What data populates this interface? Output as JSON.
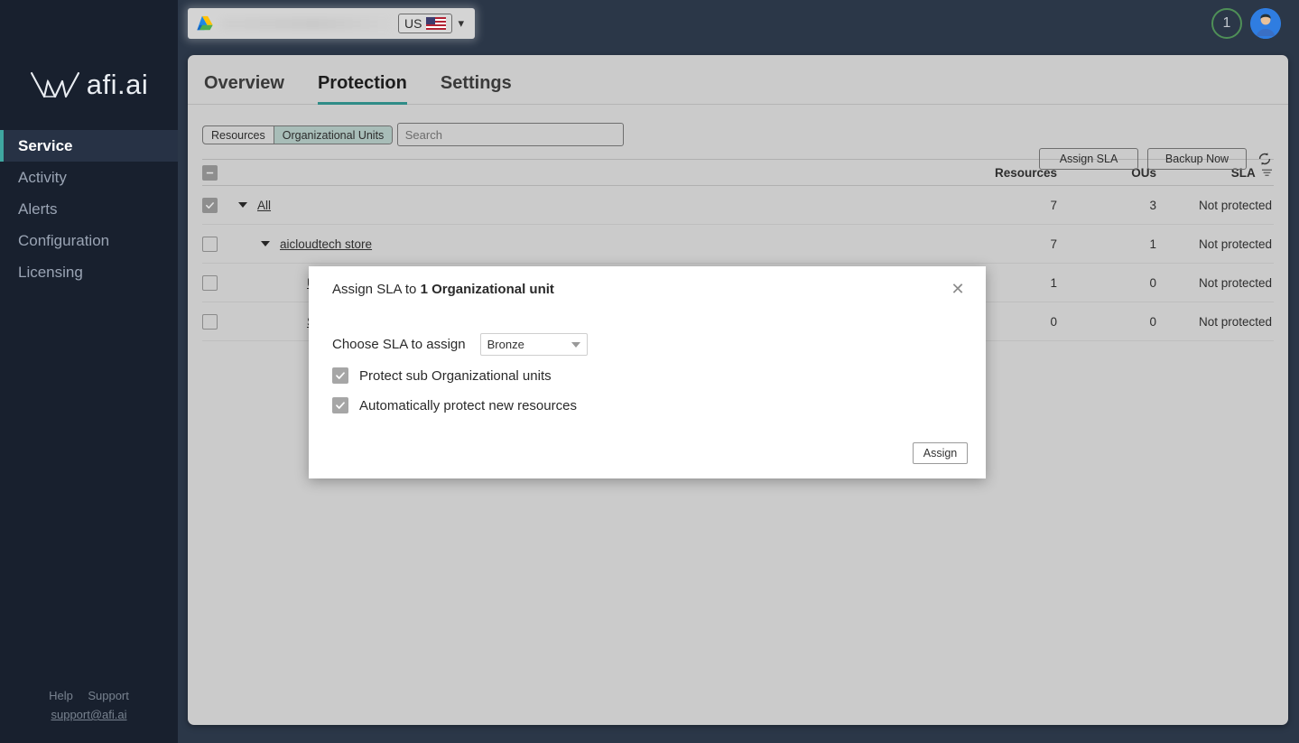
{
  "brand": {
    "name": "afi.ai",
    "accent": "#3fa6a0",
    "sidebar_bg": "#18202e"
  },
  "sidebar": {
    "items": [
      {
        "label": "Service",
        "active": true
      },
      {
        "label": "Activity",
        "active": false
      },
      {
        "label": "Alerts",
        "active": false
      },
      {
        "label": "Configuration",
        "active": false
      },
      {
        "label": "Licensing",
        "active": false
      }
    ],
    "footer": {
      "help": "Help",
      "support": "Support",
      "email": "support@afi.ai"
    }
  },
  "topbar": {
    "account_icon": "google-drive-icon",
    "account_name": "",
    "region": "US",
    "region_flag": "us-flag-icon",
    "notification_count": "1",
    "avatar": "user-avatar"
  },
  "tabs": [
    {
      "label": "Overview",
      "active": false
    },
    {
      "label": "Protection",
      "active": true
    },
    {
      "label": "Settings",
      "active": false
    }
  ],
  "segmented": [
    {
      "label": "Resources",
      "active": false
    },
    {
      "label": "Organizational Units",
      "active": true
    }
  ],
  "search": {
    "placeholder": "Search",
    "value": ""
  },
  "toolbar": {
    "assign_sla_label": "Assign SLA",
    "backup_now_label": "Backup Now",
    "refresh_icon": "refresh-icon"
  },
  "table": {
    "columns": {
      "resources": "Resources",
      "ous": "OUs",
      "sla": "SLA"
    },
    "sla_filter_icon": "filter-icon",
    "header_checkbox_state": "indeterminate",
    "rows": [
      {
        "name": "All",
        "indent": 1,
        "checked": true,
        "expanded": true,
        "resources": "7",
        "ous": "3",
        "sla": "Not protected"
      },
      {
        "name": "aicloudtech store",
        "indent": 2,
        "checked": false,
        "expanded": true,
        "resources": "7",
        "ous": "1",
        "sla": "Not protected"
      },
      {
        "name": "Users",
        "indent": 3,
        "checked": false,
        "expanded": false,
        "resources": "1",
        "ous": "0",
        "sla": "Not protected"
      },
      {
        "name": "Shared drives",
        "indent": 3,
        "checked": false,
        "expanded": false,
        "resources": "0",
        "ous": "0",
        "sla": "Not protected"
      }
    ]
  },
  "modal": {
    "title_prefix": "Assign SLA to ",
    "title_strong": "1 Organizational unit",
    "close_icon": "close-icon",
    "sla_label": "Choose SLA to assign",
    "sla_value": "Bronze",
    "checkbox_1": "Protect sub Organizational units",
    "checkbox_2": "Automatically protect new resources",
    "assign_label": "Assign"
  }
}
